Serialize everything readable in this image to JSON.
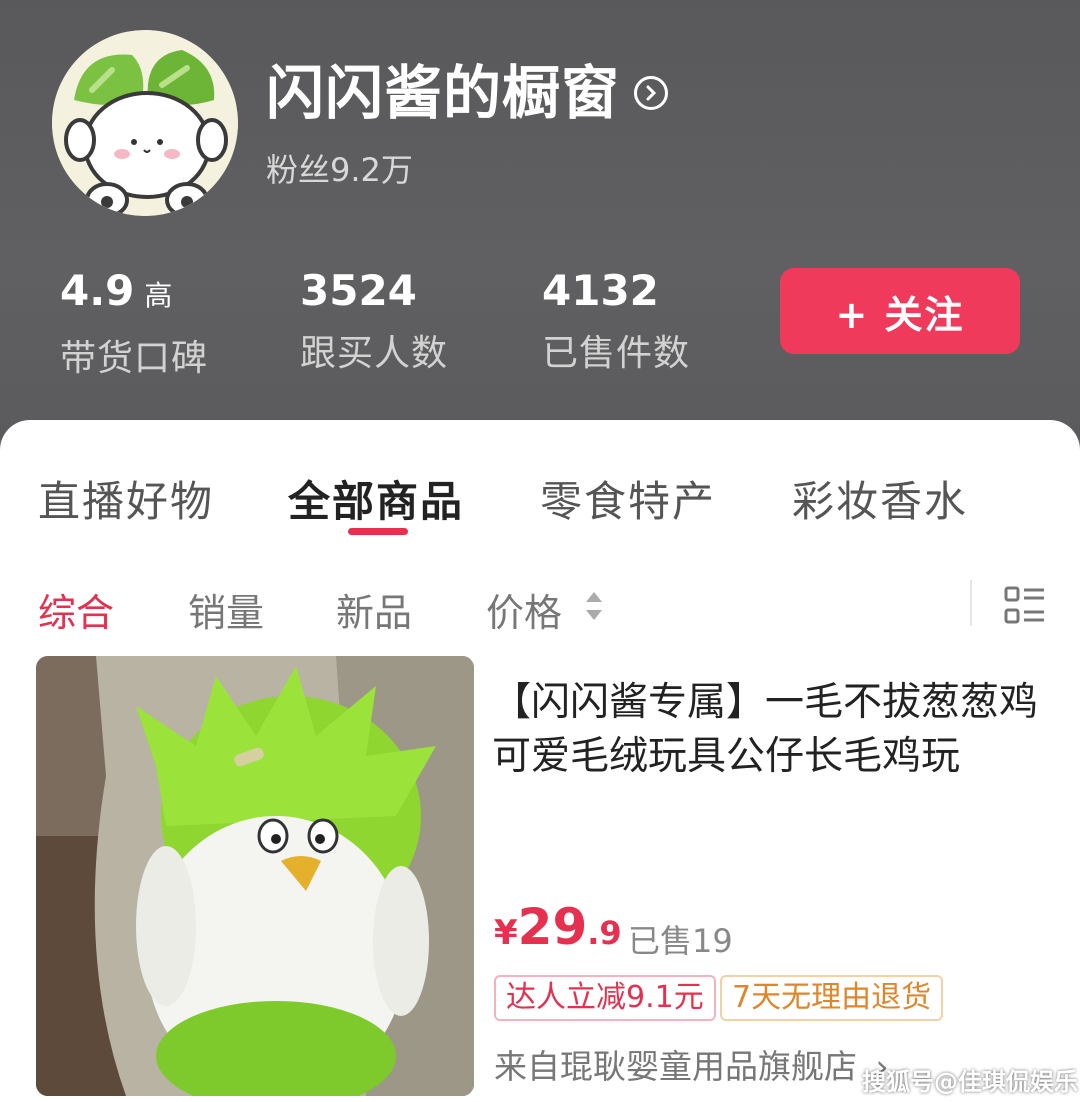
{
  "shop": {
    "title": "闪闪酱的橱窗",
    "fans": "粉丝9.2万"
  },
  "stats": [
    {
      "value": "4.9",
      "suffix": "高",
      "label": "带货口碑"
    },
    {
      "value": "3524",
      "suffix": "",
      "label": "跟买人数"
    },
    {
      "value": "4132",
      "suffix": "",
      "label": "已售件数"
    }
  ],
  "follow_label": "+ 关注",
  "tabs": [
    {
      "label": "直播好物"
    },
    {
      "label": "全部商品"
    },
    {
      "label": "零食特产"
    },
    {
      "label": "彩妆香水"
    }
  ],
  "sort": [
    {
      "label": "综合"
    },
    {
      "label": "销量"
    },
    {
      "label": "新品"
    },
    {
      "label": "价格"
    }
  ],
  "product": {
    "title": "【闪闪酱专属】一毛不拔葱葱鸡可爱毛绒玩具公仔长毛鸡玩",
    "price_symbol": "¥",
    "price_int": "29",
    "price_dec": ".9",
    "sold": "已售19",
    "tag1": "达人立减9.1元",
    "tag2": "7天无理由退货",
    "store": "来自琨耿婴童用品旗舰店"
  },
  "watermark": "搜狐号@佳琪侃娱乐",
  "colors": {
    "accent": "#e5304f",
    "follow_bg": "#f03a5b",
    "tag_orange": "#e0862a"
  }
}
